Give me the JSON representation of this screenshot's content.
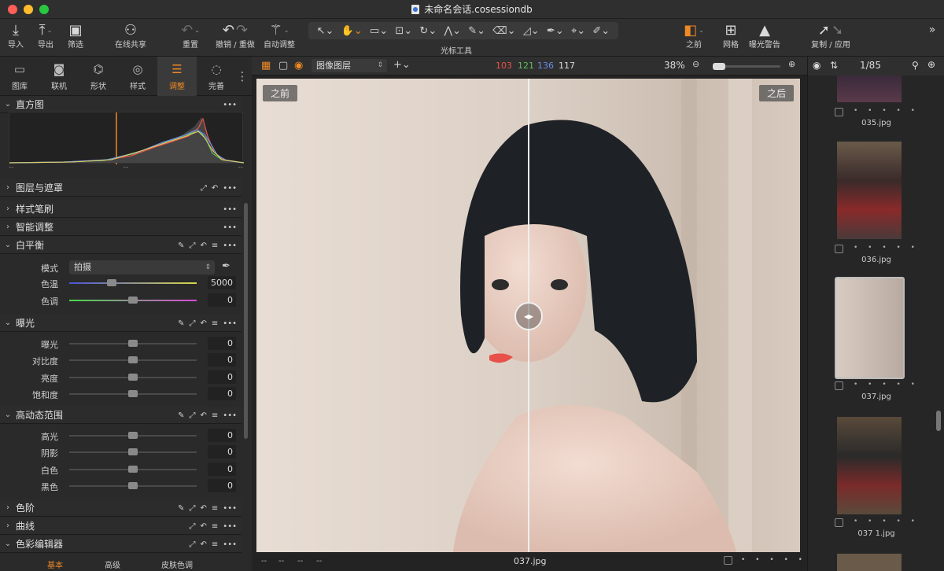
{
  "window": {
    "title": "未命名会话.cosessiondb"
  },
  "toolbar": {
    "import": "导入",
    "export": "导出",
    "filter": "筛选",
    "share": "在线共享",
    "reset": "重置",
    "undo_redo": "撤销 / 重做",
    "auto_adjust": "自动调整",
    "cursor_tools": "光标工具",
    "before": "之前",
    "grid": "网格",
    "exposure_warning": "曝光警告",
    "copy_apply": "复制 / 应用"
  },
  "panel_tabs": [
    "图库",
    "联机",
    "形状",
    "样式",
    "调整",
    "完善"
  ],
  "histogram": {
    "title": "直方图",
    "lbl_left": "--",
    "lbl_mid": "--",
    "lbl_right": "--"
  },
  "sections": {
    "layers": "图层与遮罩",
    "style_brush": "样式笔刷",
    "smart_adjust": "智能调整",
    "white_balance": "白平衡",
    "exposure": "曝光",
    "hdr": "高动态范围",
    "levels": "色阶",
    "curves": "曲线",
    "color_editor": "色彩编辑器"
  },
  "white_balance": {
    "mode_label": "模式",
    "mode_value": "拍摄",
    "temp_label": "色温",
    "temp_value": "5000",
    "tint_label": "色调",
    "tint_value": "0"
  },
  "exposure": [
    {
      "label": "曝光",
      "value": "0"
    },
    {
      "label": "对比度",
      "value": "0"
    },
    {
      "label": "亮度",
      "value": "0"
    },
    {
      "label": "饱和度",
      "value": "0"
    }
  ],
  "hdr": [
    {
      "label": "高光",
      "value": "0"
    },
    {
      "label": "阴影",
      "value": "0"
    },
    {
      "label": "白色",
      "value": "0"
    },
    {
      "label": "黑色",
      "value": "0"
    }
  ],
  "color_editor_tabs": [
    "基本",
    "高级",
    "皮肤色调"
  ],
  "viewer": {
    "layer_select": "图像图层",
    "rgb": {
      "r": "103",
      "g": "121",
      "b": "136",
      "l": "117"
    },
    "zoom": "38%",
    "before_label": "之前",
    "after_label": "之后",
    "filename": "037.jpg",
    "bottom_left": [
      "--",
      "--",
      "--",
      "--"
    ]
  },
  "browser": {
    "counter": "1/85",
    "thumbs": [
      "035.jpg",
      "036.jpg",
      "037.jpg",
      "037 1.jpg"
    ],
    "dots": "• • • • •"
  },
  "colors": {
    "accent": "#f08a24",
    "red": "#e8534a",
    "green": "#5dc05d",
    "blue": "#6a8ee8"
  }
}
